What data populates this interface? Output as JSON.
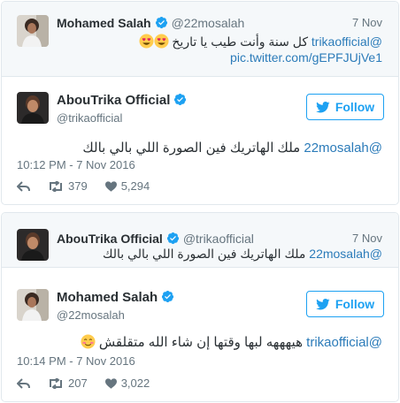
{
  "tweet1": {
    "quoted": {
      "name": "Mohamed Salah",
      "handle": "@22mosalah",
      "date": "7 Nov",
      "text_mention": "@trikaofficial",
      "text_body": "كل سنة وأنت طيب يا تاريخ",
      "link": "pic.twitter.com/gEPFJUjVe1"
    },
    "author": {
      "name": "AbouTrika Official",
      "handle": "@trikaofficial"
    },
    "follow_label": "Follow",
    "text_mention": "@22mosalah",
    "text_body": "ملك الهاتريك فين الصورة اللي بالي بالك",
    "timestamp": "10:12 PM - 7 Nov 2016",
    "retweets": "379",
    "likes": "5,294"
  },
  "tweet2": {
    "quoted": {
      "name": "AbouTrika Official",
      "handle": "@trikaofficial",
      "date": "7 Nov",
      "text_mention": "@22mosalah",
      "text_body": "ملك الهاتريك فين الصورة اللي بالي بالك"
    },
    "author": {
      "name": "Mohamed Salah",
      "handle": "@22mosalah"
    },
    "follow_label": "Follow",
    "text_mention": "@trikaofficial",
    "text_body": "هيهههه لبها وقتها إن شاء الله متقلقش",
    "timestamp": "10:14 PM - 7 Nov 2016",
    "retweets": "207",
    "likes": "3,022"
  },
  "colors": {
    "link": "#2b7bb9",
    "brand_blue": "#1da1f2",
    "muted": "#66757f",
    "border": "#e1e8ed",
    "quote_bg": "#f5f8fa"
  },
  "icons": [
    "verified-badge-icon",
    "twitter-bird-icon",
    "reply-icon",
    "retweet-icon",
    "heart-icon",
    "heart-eyes-emoji",
    "smiling-blush-emoji"
  ]
}
